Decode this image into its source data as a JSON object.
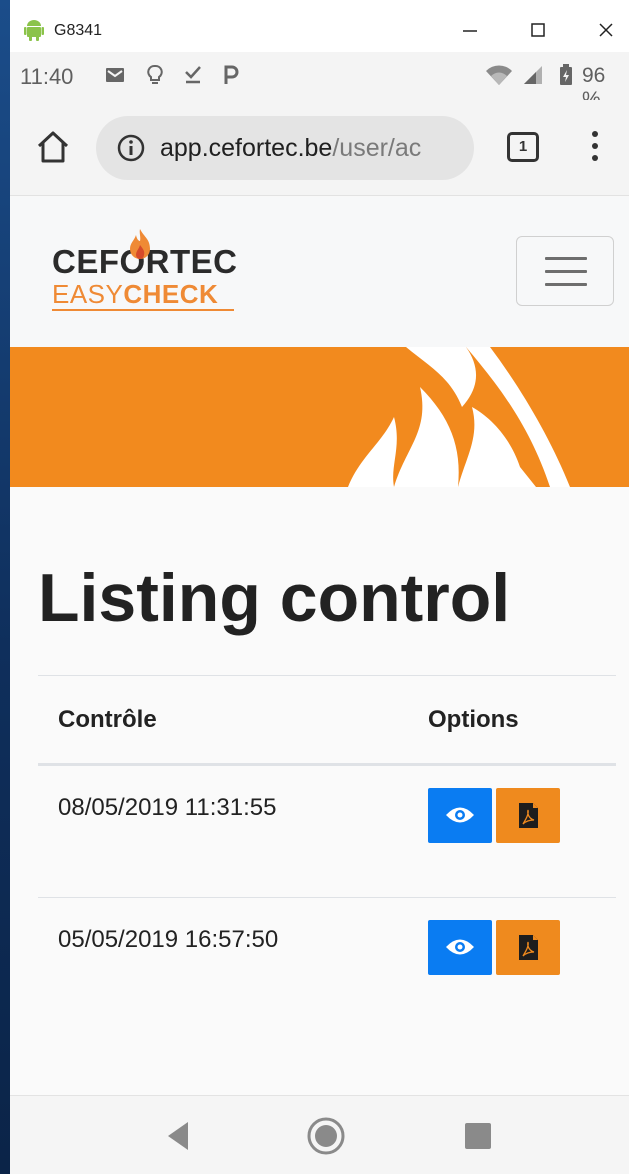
{
  "window": {
    "title": "G8341",
    "controls": [
      "minimize",
      "maximize",
      "close"
    ]
  },
  "status_bar": {
    "time": "11:40",
    "battery": "96 %",
    "icons": [
      "gmail-icon",
      "bulb-icon",
      "download-done-icon",
      "parking-icon",
      "wifi-icon",
      "signal-icon",
      "battery-icon"
    ]
  },
  "browser": {
    "url_host": "app.cefortec.be",
    "url_path": "/user/ac",
    "tab_count": "1"
  },
  "site": {
    "logo_line1": "CEFORTEC",
    "logo_easy": "EASY",
    "logo_check": "CHECK",
    "brand_orange": "#f28a1e",
    "action_blue": "#0a7cf2"
  },
  "page": {
    "title": "Listing control",
    "columns": [
      "Contrôle",
      "Options"
    ],
    "rows": [
      {
        "date": "08/05/2019 11:31:55"
      },
      {
        "date": "05/05/2019 16:57:50"
      }
    ]
  },
  "nav": [
    "back",
    "home",
    "recent-apps"
  ]
}
